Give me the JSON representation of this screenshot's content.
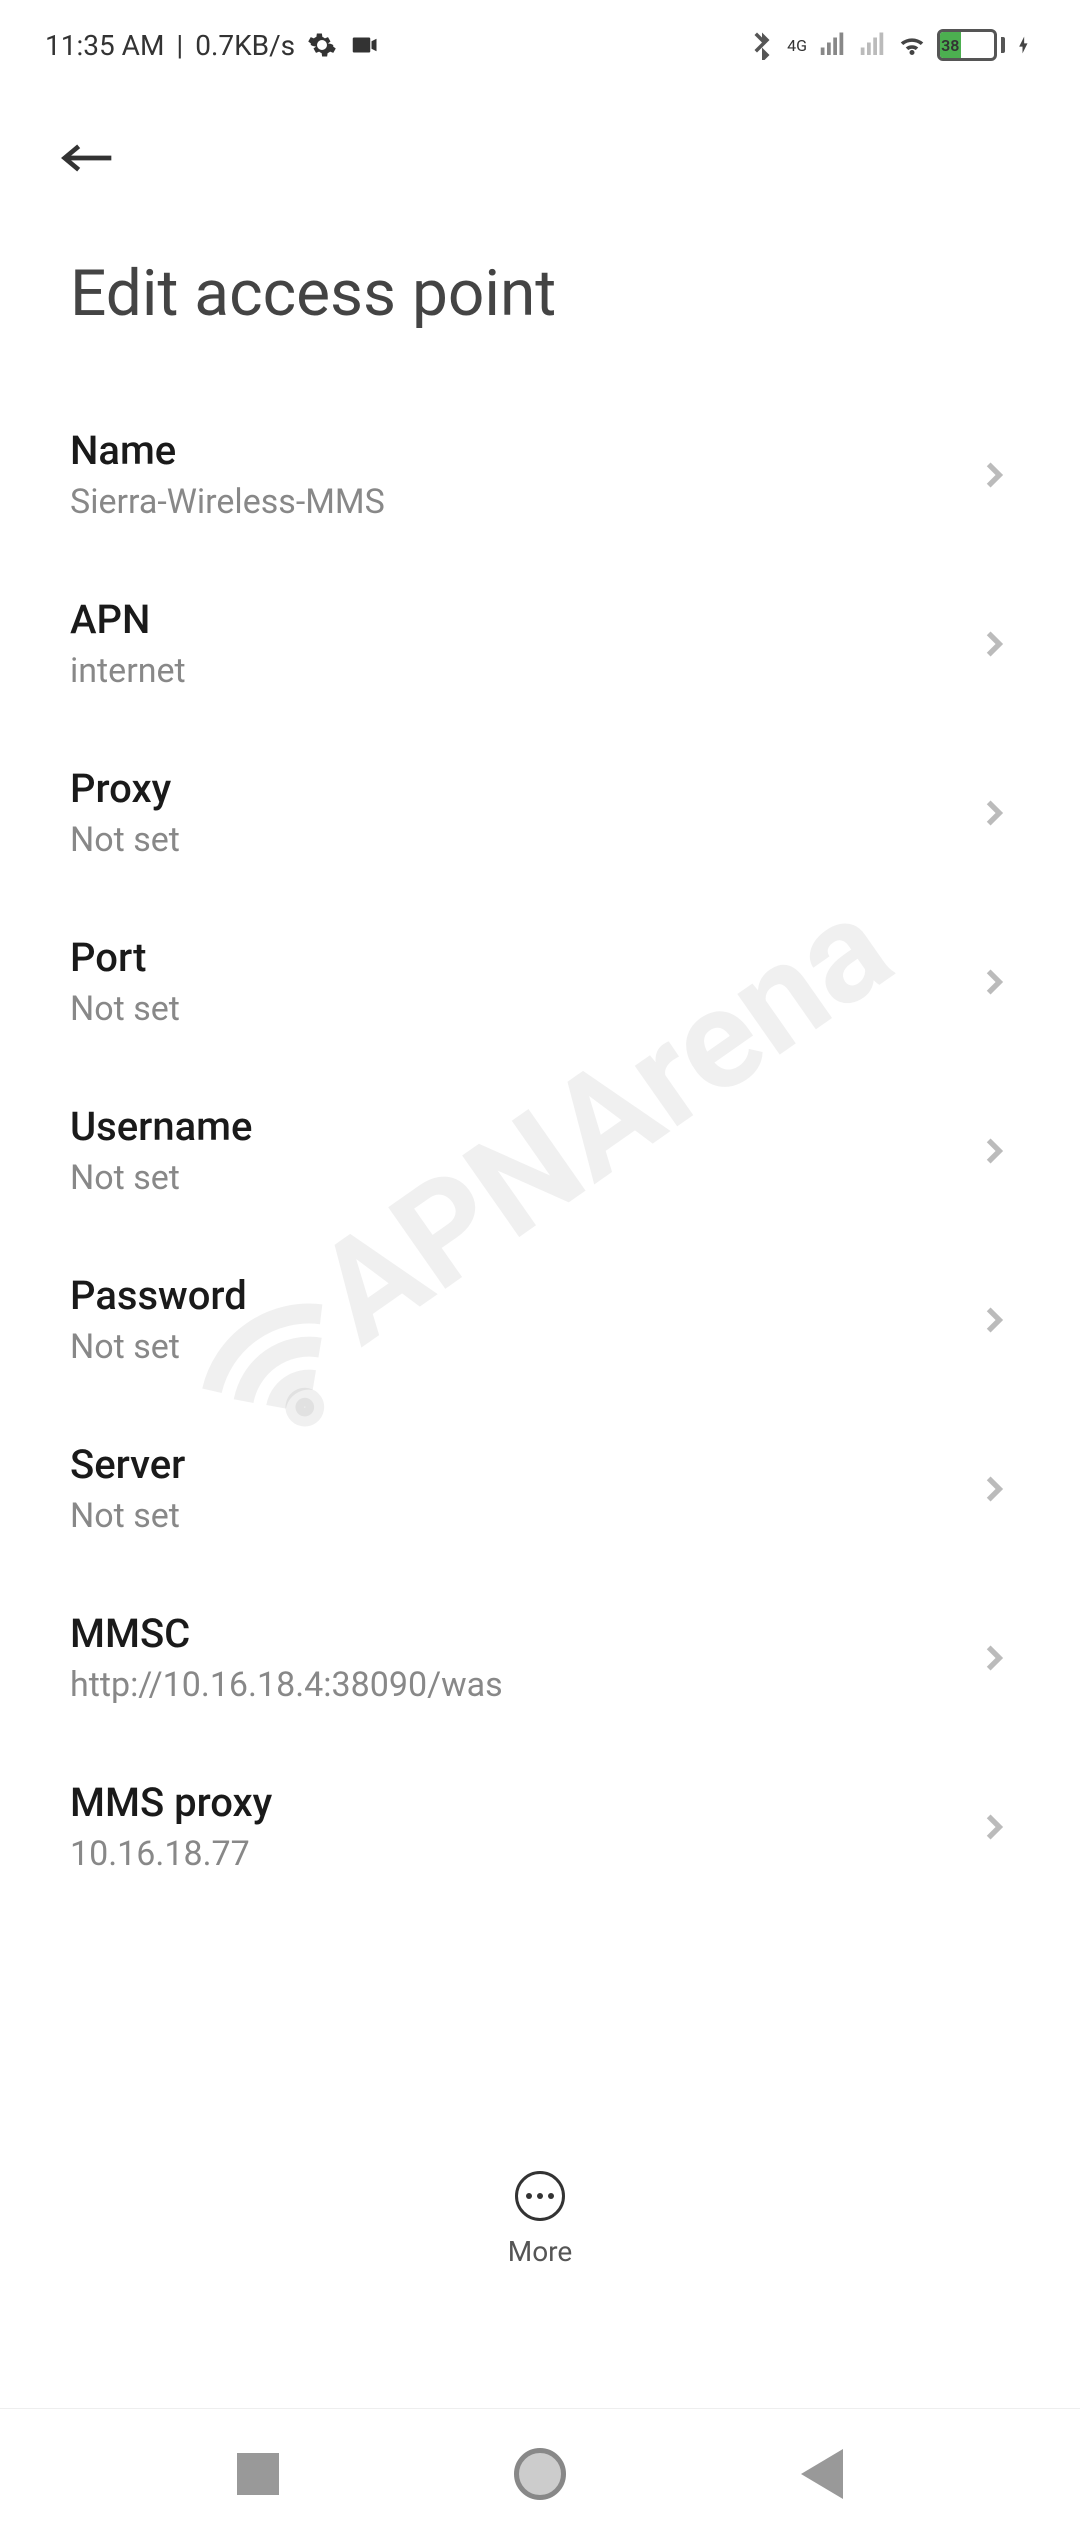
{
  "status": {
    "time": "11:35 AM",
    "speed": "0.7KB/s",
    "signal_type": "4G",
    "battery_pct": "38"
  },
  "page": {
    "title": "Edit access point"
  },
  "footer": {
    "more": "More"
  },
  "watermark": "APNArena",
  "items": [
    {
      "label": "Name",
      "value": "Sierra-Wireless-MMS"
    },
    {
      "label": "APN",
      "value": "internet"
    },
    {
      "label": "Proxy",
      "value": "Not set"
    },
    {
      "label": "Port",
      "value": "Not set"
    },
    {
      "label": "Username",
      "value": "Not set"
    },
    {
      "label": "Password",
      "value": "Not set"
    },
    {
      "label": "Server",
      "value": "Not set"
    },
    {
      "label": "MMSC",
      "value": "http://10.16.18.4:38090/was"
    },
    {
      "label": "MMS proxy",
      "value": "10.16.18.77"
    }
  ]
}
